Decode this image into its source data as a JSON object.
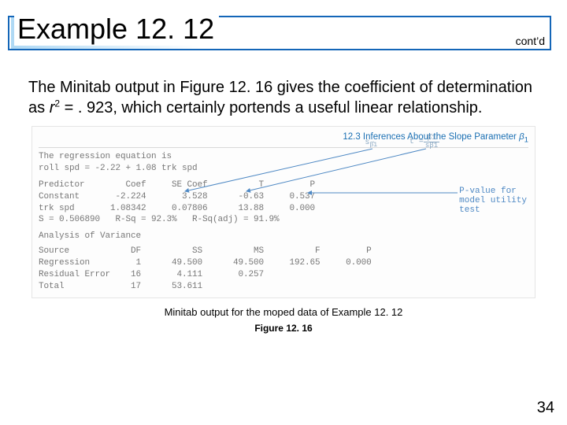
{
  "title": "Example 12. 12",
  "contd": "cont’d",
  "paragraph_pre": "The Minitab output in Figure 12. 16 gives the coefficient of determination as ",
  "paragraph_r": "r",
  "paragraph_sup": "2",
  "paragraph_post": " = . 923, which certainly portends a useful linear relationship.",
  "mt": {
    "section_header_pre": "12.3  Inferences About the Slope Parameter ",
    "section_header_beta": "β",
    "section_header_sub": "1",
    "eq_line1": "The regression equation is",
    "eq_line2": "roll spd = -2.22 + 1.08 trk spd",
    "tbl_hdr": "Predictor        Coef     SE Coef          T         P",
    "tbl_r1": "Constant       -2.224       3.528      -0.63     0.537",
    "tbl_r2": "trk spd       1.08342     0.07806      13.88     0.000",
    "sline": "S = 0.506890   R-Sq = 92.3%   R-Sq(adj) = 91.9%",
    "anova_title": "Analysis of Variance",
    "an_hdr": "Source            DF          SS          MS          F         P",
    "an_r1": "Regression         1      49.500      49.500     192.65     0.000",
    "an_r2": "Residual Error    16       4.111       0.257",
    "an_r3": "Total             17      53.611",
    "annot_sb1": "s",
    "annot_sb1_sub": "β̂1",
    "annot_t": "t = ",
    "annot_t_frac_top": "β̂1",
    "annot_t_frac_bot": "sβ̂1",
    "annot_pval_l1": "P-value for",
    "annot_pval_l2": "model utility",
    "annot_pval_l3": "test"
  },
  "caption1": "Minitab output for the moped data of Example 12. 12",
  "caption2": "Figure 12. 16",
  "pagenum": "34"
}
